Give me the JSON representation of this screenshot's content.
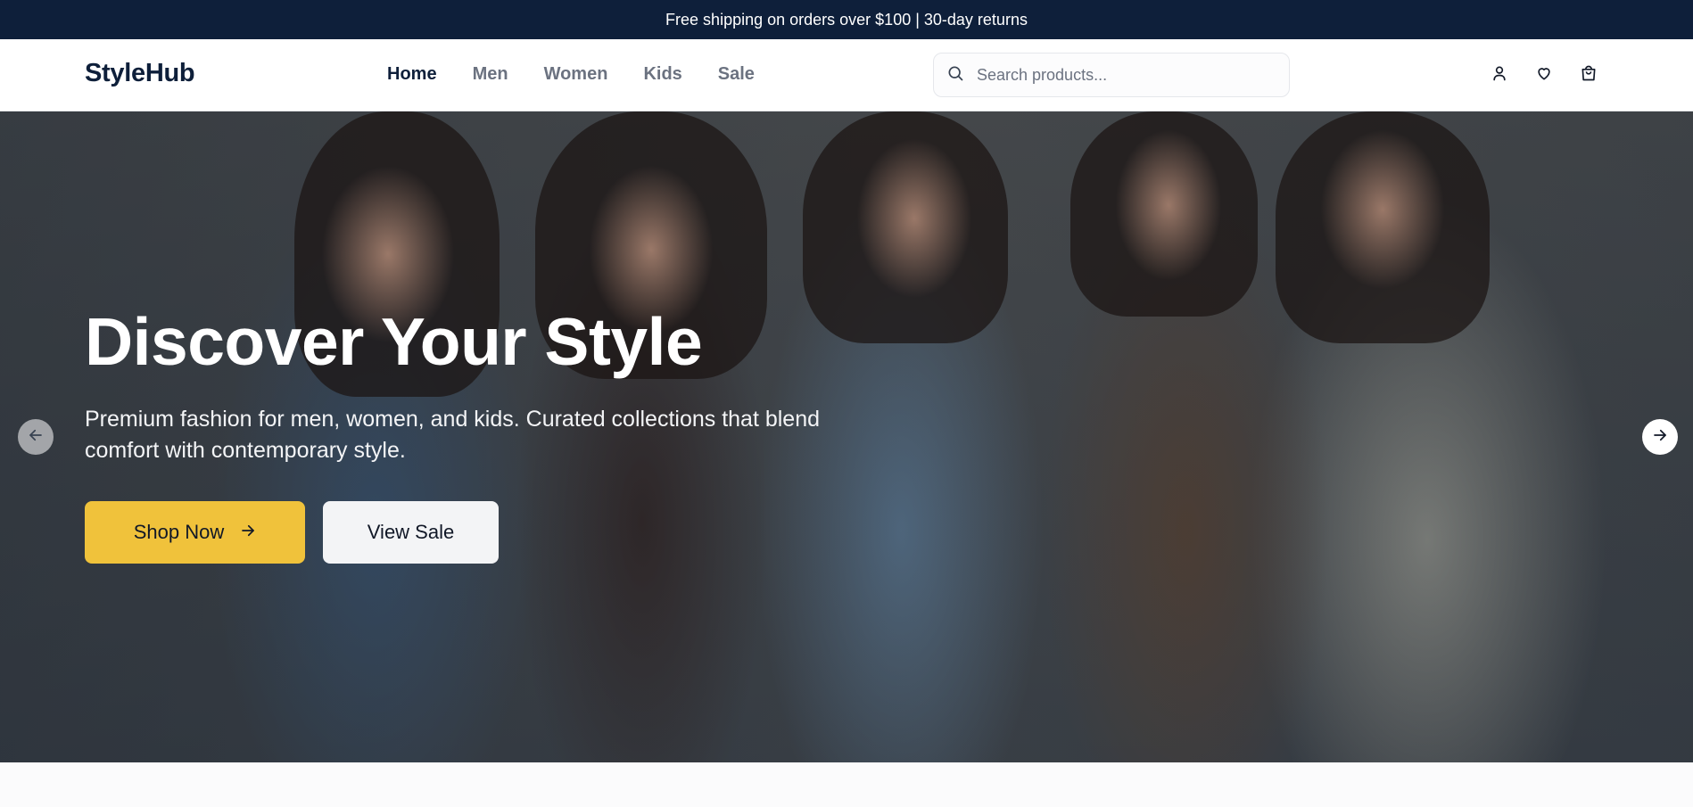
{
  "announcement": "Free shipping on orders over $100 | 30-day returns",
  "brand": "StyleHub",
  "nav": {
    "items": [
      {
        "label": "Home",
        "active": true
      },
      {
        "label": "Men",
        "active": false
      },
      {
        "label": "Women",
        "active": false
      },
      {
        "label": "Kids",
        "active": false
      },
      {
        "label": "Sale",
        "active": false
      }
    ]
  },
  "search": {
    "placeholder": "Search products...",
    "value": ""
  },
  "header_icons": [
    "user-icon",
    "heart-icon",
    "shopping-bag-icon"
  ],
  "hero": {
    "title": "Discover Your Style",
    "subtitle": "Premium fashion for men, women, and kids. Curated collections that blend comfort with contemporary style.",
    "primary_button": "Shop Now",
    "secondary_button": "View Sale",
    "prev_icon": "arrow-left-icon",
    "next_icon": "arrow-right-icon"
  },
  "colors": {
    "announcement_bg": "#0e1f3a",
    "brand": "#0e1f3a",
    "accent": "#f0c23b",
    "nav_inactive": "#6b7280"
  }
}
